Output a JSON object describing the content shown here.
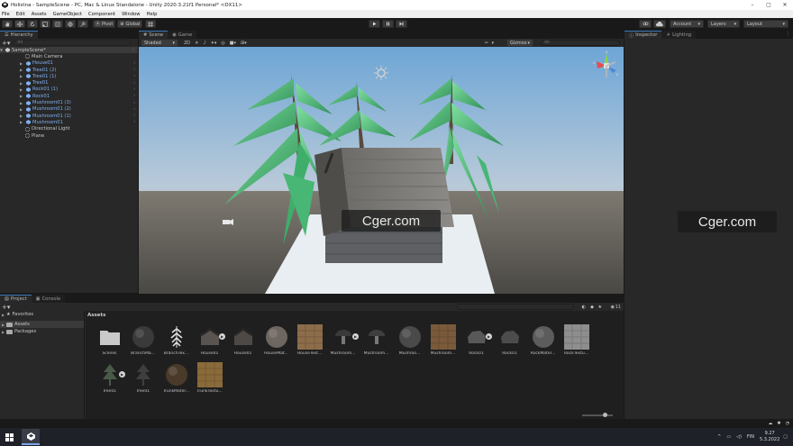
{
  "window": {
    "title": "Holistna - SampleScene - PC, Mac & Linux Standalone - Unity 2020.3.21f1 Personal* <DX11>",
    "controls": [
      "–",
      "▢",
      "✕"
    ]
  },
  "menu": [
    "File",
    "Edit",
    "Assets",
    "GameObject",
    "Component",
    "Window",
    "Help"
  ],
  "toolbar": {
    "pivot_label": "Pivot",
    "global_label": "Global",
    "account_label": "Account",
    "layers_label": "Layers",
    "layout_label": "Layout"
  },
  "hierarchy": {
    "tab": "Hierarchy",
    "search_placeholder": "All",
    "scene_name": "SampleScene*",
    "items": [
      {
        "label": "Main Camera",
        "prefab": false,
        "icon": "cube-outline-icon"
      },
      {
        "label": "House01",
        "prefab": true,
        "icon": "prefab-cube-icon"
      },
      {
        "label": "Tree01 (2)",
        "prefab": true,
        "icon": "prefab-cube-icon"
      },
      {
        "label": "Tree01 (1)",
        "prefab": true,
        "icon": "prefab-cube-icon"
      },
      {
        "label": "Tree01",
        "prefab": true,
        "icon": "prefab-cube-icon"
      },
      {
        "label": "Rock01 (1)",
        "prefab": true,
        "icon": "prefab-cube-icon"
      },
      {
        "label": "Rock01",
        "prefab": true,
        "icon": "prefab-cube-icon"
      },
      {
        "label": "Mushroom01 (3)",
        "prefab": true,
        "icon": "prefab-cube-icon"
      },
      {
        "label": "Mushroom01 (2)",
        "prefab": true,
        "icon": "prefab-cube-icon"
      },
      {
        "label": "Mushroom01 (1)",
        "prefab": true,
        "icon": "prefab-cube-icon"
      },
      {
        "label": "Mushroom01",
        "prefab": true,
        "icon": "prefab-cube-icon"
      },
      {
        "label": "Directional Light",
        "prefab": false,
        "icon": "cube-outline-icon"
      },
      {
        "label": "Plane",
        "prefab": false,
        "icon": "cube-outline-icon"
      }
    ]
  },
  "scene": {
    "tabs": [
      "Scene",
      "Game"
    ],
    "shading_mode": "Shaded",
    "view_mode": "2D",
    "gizmos_label": "Gizmos",
    "search_placeholder": "All",
    "gizmo_axes": [
      "y",
      "x",
      "z"
    ]
  },
  "inspector": {
    "tabs": [
      "Inspector",
      "Lighting"
    ]
  },
  "project": {
    "tabs": [
      "Project",
      "Console"
    ],
    "sidebar": [
      {
        "label": "Favorites",
        "selected": false
      },
      {
        "label": "Assets",
        "selected": true
      },
      {
        "label": "Packages",
        "selected": false
      }
    ],
    "breadcrumb": "Assets",
    "layer_count": "11",
    "zoom_fraction": 0.75,
    "assets": [
      {
        "label": "Scenes",
        "kind": "folder",
        "color": "#c9c9c9",
        "play": false
      },
      {
        "label": "BranchMa...",
        "kind": "sphere",
        "color": "#3a3a3a",
        "play": false
      },
      {
        "label": "BranchTex...",
        "kind": "branch",
        "color": "#e6e6e6",
        "play": false
      },
      {
        "label": "House01",
        "kind": "house",
        "color": "#5a5450",
        "play": true
      },
      {
        "label": "House01",
        "kind": "house",
        "color": "#4e4945",
        "play": false
      },
      {
        "label": "HouseMat...",
        "kind": "sphere",
        "color": "#6e6660",
        "play": false
      },
      {
        "label": "HouseText...",
        "kind": "texture",
        "color": "#8c6d4a",
        "play": false
      },
      {
        "label": "Mushroom...",
        "kind": "mushroom",
        "color": "#3a3a3a",
        "play": true
      },
      {
        "label": "Mushroom...",
        "kind": "mushroom",
        "color": "#3e3e3e",
        "play": false
      },
      {
        "label": "Mushroo...",
        "kind": "sphere",
        "color": "#4a4a4a",
        "play": false
      },
      {
        "label": "Mushroom...",
        "kind": "texture",
        "color": "#7a5a3a",
        "play": false
      },
      {
        "label": "Rock01",
        "kind": "rock",
        "color": "#585858",
        "play": true
      },
      {
        "label": "Rock01",
        "kind": "rock",
        "color": "#4c4c4c",
        "play": false
      },
      {
        "label": "RockMater...",
        "kind": "sphere",
        "color": "#5c5c5c",
        "play": false
      },
      {
        "label": "RockTextu...",
        "kind": "texture",
        "color": "#8e8e8e",
        "play": false
      },
      {
        "label": "Tree01",
        "kind": "tree",
        "color": "#4a5a4a",
        "play": true
      },
      {
        "label": "Tree01",
        "kind": "tree",
        "color": "#3e3e3e",
        "play": false
      },
      {
        "label": "TrunkMater...",
        "kind": "sphere",
        "color": "#4a3a2a",
        "play": false
      },
      {
        "label": "TrunkTextu...",
        "kind": "texture",
        "color": "#8a6a3a",
        "play": false
      }
    ]
  },
  "status": {
    "icons": [
      "cloud-sync-icon",
      "bug-icon",
      "clock-icon"
    ]
  },
  "taskbar": {
    "language": "FIN",
    "time": "9.27",
    "date": "5.3.2022"
  },
  "watermark": "Cger.com",
  "colors": {
    "accent": "#3a79bb",
    "prefab_text": "#7fb0ef",
    "foliage": "#4fc07a",
    "sky_top": "#6ea6d6",
    "ground": "#5c5a55"
  }
}
